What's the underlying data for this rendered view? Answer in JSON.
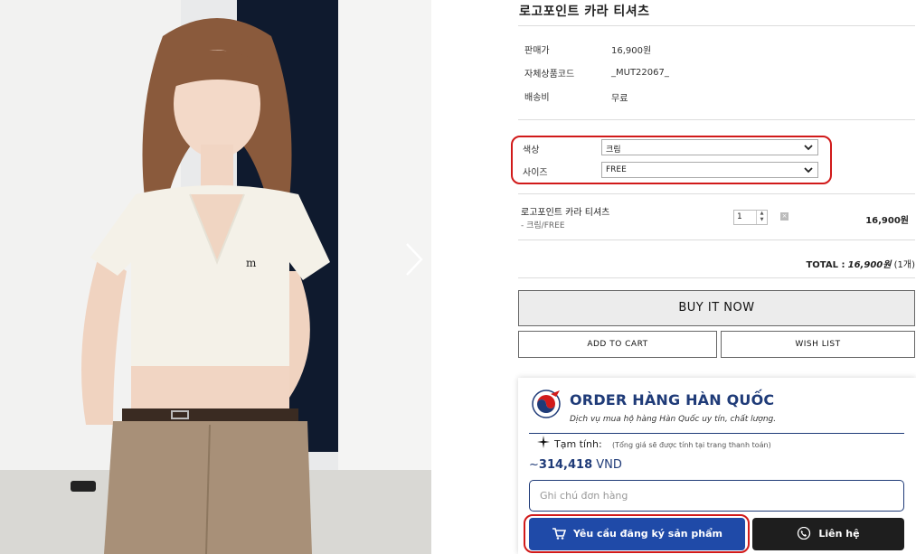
{
  "product": {
    "title": "로고포인트 카라 티셔츠",
    "info": [
      {
        "label": "판매가",
        "value": "16,900원"
      },
      {
        "label": "자체상품코드",
        "value": "_MUT22067_"
      },
      {
        "label": "배송비",
        "value": "무료"
      }
    ]
  },
  "options": {
    "color_label": "색상",
    "color_value": "크림",
    "size_label": "사이즈",
    "size_value": "FREE"
  },
  "selected_item": {
    "name": "로고포인트 카라 티셔츠",
    "variant": "- 크림/FREE",
    "quantity": "1",
    "delete_glyph": "×",
    "price": "16,900원"
  },
  "total": {
    "label": "TOTAL :",
    "amount": "16,900원",
    "count": "(1개)"
  },
  "buttons": {
    "buy_now": "BUY IT NOW",
    "add_to_cart": "ADD TO CART",
    "wish_list": "WISH LIST"
  },
  "order_widget": {
    "brand": "ORDER HÀNG HÀN QUỐC",
    "tagline": "Dịch vụ mua hộ hàng Hàn Quốc uy tín, chất lượng.",
    "estimate_label": "Tạm tính:",
    "estimate_note": "(Tổng giá sẽ được tính tại trang thanh toán)",
    "price_prefix": "~",
    "price_value": "314,418",
    "price_currency": "VND",
    "note_placeholder": "Ghi chú đơn hàng",
    "register_button": "Yêu cầu đăng ký sản phẩm",
    "contact_button": "Liên hệ"
  },
  "icons": {
    "next": "chevron-right-icon",
    "select": "chevron-down-icon",
    "cart": "cart-icon",
    "phone": "phone-icon",
    "sparkle": "sparkle-icon"
  },
  "colors": {
    "highlight": "#d11a1a",
    "brand_navy": "#1f3b78",
    "register_blue": "#1f4aa8",
    "contact_dark": "#1e1e1e"
  }
}
